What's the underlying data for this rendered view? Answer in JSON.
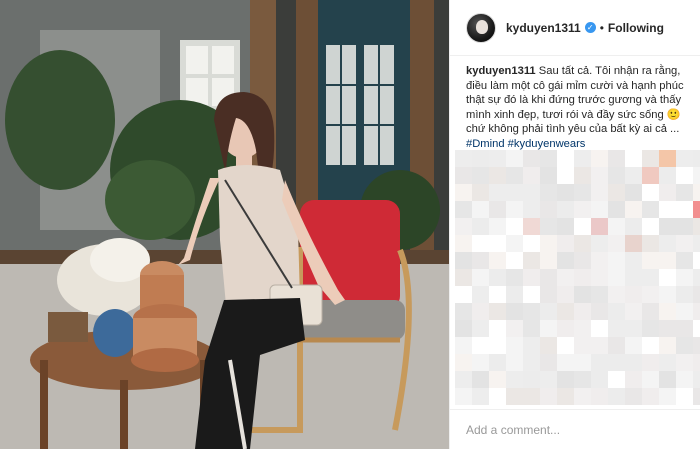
{
  "post": {
    "username": "kyduyen1311",
    "verified": true,
    "separator": "•",
    "follow_status": "Following",
    "caption_text": "Sau tất cả. Tôi nhận ra rằng, điều làm một cô gái mỉm cười và hạnh phúc thật sự đó là khi đứng trước gương và thấy mình xinh đẹp, tươi rói và đầy sức sống 🙂 chứ không phải tình yêu của bất kỳ ai cả ... ",
    "hashtags": [
      "#Dmind",
      "#kyduyenwears"
    ],
    "comments_obscured": true,
    "add_comment_placeholder": "Add a comment..."
  },
  "icons": {
    "verified": "verified-check-icon",
    "avatar": "profile-avatar"
  },
  "colors": {
    "verified_blue": "#3897f0",
    "hashtag": "#003569",
    "text": "#262626",
    "placeholder": "#999999",
    "divider": "#efefef"
  }
}
